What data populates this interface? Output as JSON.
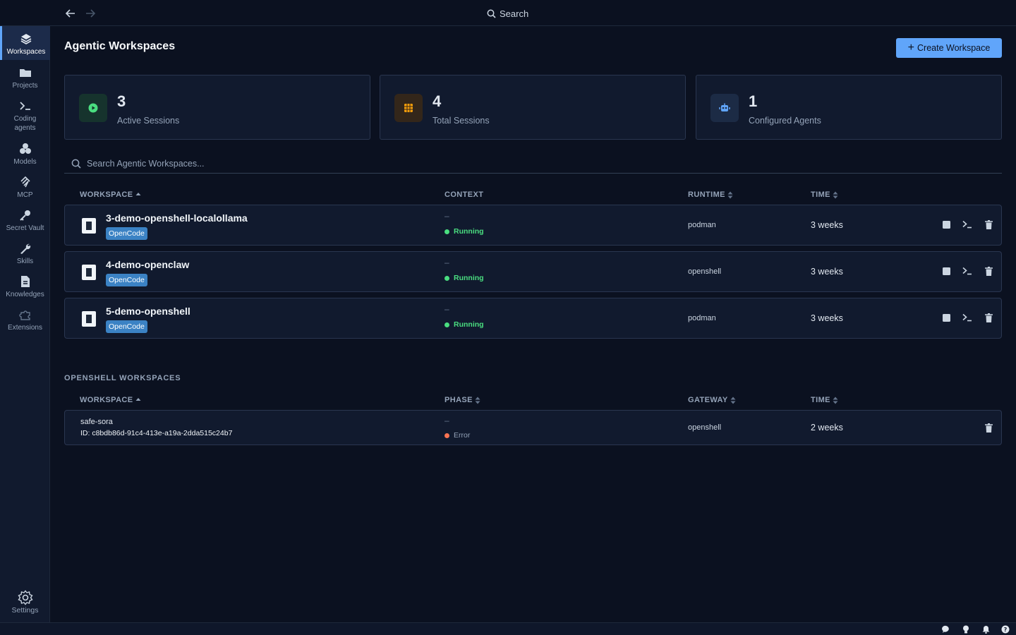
{
  "topbar": {
    "search_label": "Search"
  },
  "sidebar": {
    "items": [
      {
        "label": "Workspaces",
        "icon": "layers-icon"
      },
      {
        "label": "Projects",
        "icon": "folder-icon"
      },
      {
        "label": "Coding agents",
        "icon": "terminal-icon"
      },
      {
        "label": "Models",
        "icon": "models-icon"
      },
      {
        "label": "MCP",
        "icon": "mcp-icon"
      },
      {
        "label": "Secret Vault",
        "icon": "key-icon"
      },
      {
        "label": "Skills",
        "icon": "wrench-icon"
      },
      {
        "label": "Knowledges",
        "icon": "document-icon"
      },
      {
        "label": "Extensions",
        "icon": "puzzle-icon"
      }
    ],
    "settings_label": "Settings"
  },
  "page": {
    "title": "Agentic Workspaces",
    "create_button": "Create Workspace"
  },
  "stats": [
    {
      "value": "3",
      "label": "Active Sessions",
      "icon": "play-icon",
      "color": "#4ade80"
    },
    {
      "value": "4",
      "label": "Total Sessions",
      "icon": "grid-icon",
      "color": "#f59e0b"
    },
    {
      "value": "1",
      "label": "Configured Agents",
      "icon": "robot-icon",
      "color": "#60a5fa"
    }
  ],
  "search": {
    "placeholder": "Search Agentic Workspaces..."
  },
  "workspaces_table": {
    "headers": {
      "workspace": "WORKSPACE",
      "context": "CONTEXT",
      "runtime": "RUNTIME",
      "time": "TIME"
    },
    "rows": [
      {
        "name": "3-demo-openshell-localollama",
        "badge": "OpenCode",
        "context": "–",
        "status": "Running",
        "runtime": "podman",
        "time": "3 weeks"
      },
      {
        "name": "4-demo-openclaw",
        "badge": "OpenCode",
        "context": "–",
        "status": "Running",
        "runtime": "openshell",
        "time": "3 weeks"
      },
      {
        "name": "5-demo-openshell",
        "badge": "OpenCode",
        "context": "–",
        "status": "Running",
        "runtime": "podman",
        "time": "3 weeks"
      }
    ]
  },
  "openshell": {
    "section_title": "OPENSHELL WORKSPACES",
    "headers": {
      "workspace": "WORKSPACE",
      "phase": "PHASE",
      "gateway": "GATEWAY",
      "time": "TIME"
    },
    "rows": [
      {
        "name": "safe-sora",
        "id": "ID: c8bdb86d-91c4-413e-a19a-2dda515c24b7",
        "phase_dash": "–",
        "phase": "Error",
        "gateway": "openshell",
        "time": "2 weeks"
      }
    ]
  },
  "colors": {
    "running": "#4ade80",
    "error": "#f97352",
    "accent": "#60a5fa"
  }
}
